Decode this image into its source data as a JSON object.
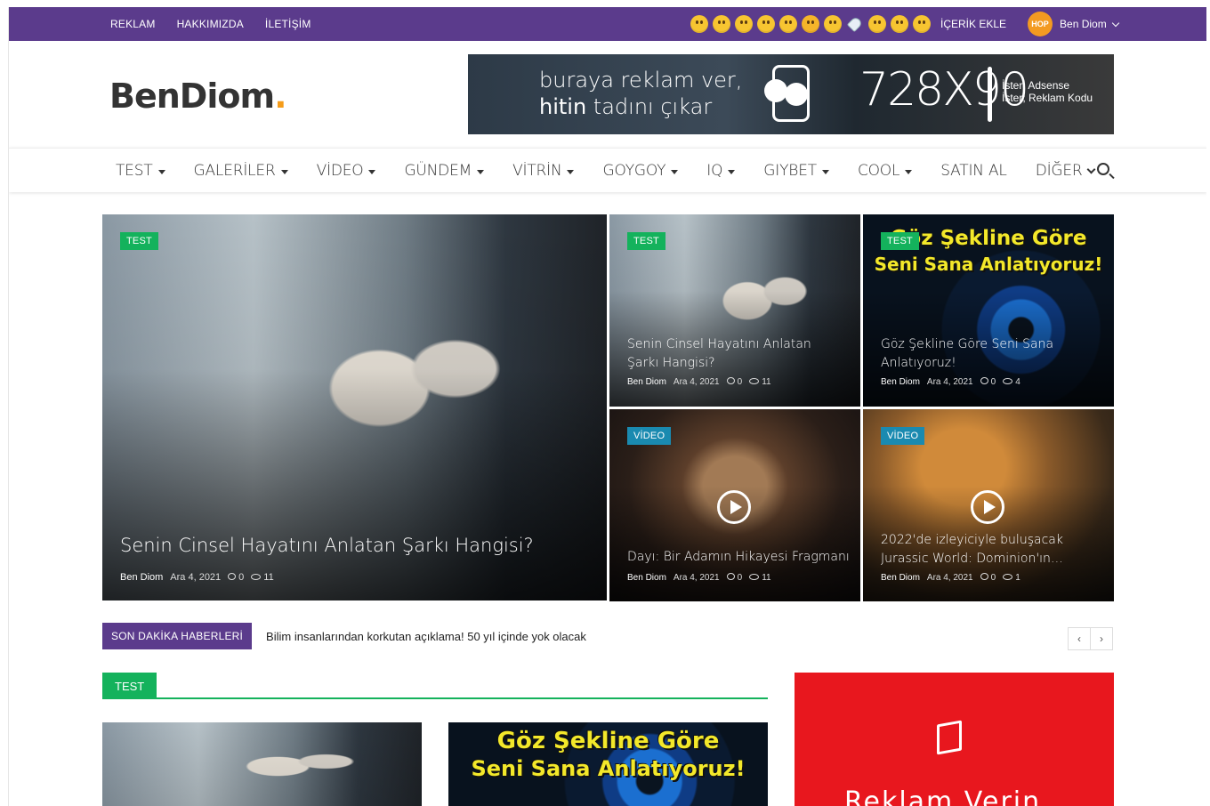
{
  "topbar": {
    "links": [
      "REKLAM",
      "HAKKIMIZDA",
      "İLETİŞİM"
    ],
    "emojis": [
      "crying-face-icon",
      "star-struck-icon",
      "neutral-face-icon",
      "blushing-face-icon",
      "hushed-face-icon",
      "heart-eyes-icon",
      "monocle-face-icon",
      "rocket-icon",
      "laughing-face-icon",
      "flushed-face-icon",
      "sunglasses-face-icon"
    ],
    "add_content": "İÇERİK EKLE",
    "avatar_text": "HOP",
    "username": "Ben Diom"
  },
  "logo": {
    "text": "BenDiom",
    "dot": "."
  },
  "ad_banner": {
    "line1": "buraya reklam ver,",
    "line2_bold": "hitin",
    "line2_rest": " tadını çıkar",
    "size": "728X90",
    "opt1": "İster; Adsense",
    "opt2": "İster; Reklam Kodu"
  },
  "nav": {
    "items": [
      "TEST",
      "GALERİLER",
      "VİDEO",
      "GÜNDEM",
      "VİTRİN",
      "GOYGOY",
      "IQ",
      "GIYBET",
      "COOL",
      "SATIN AL",
      "DİĞER"
    ]
  },
  "featured": [
    {
      "badge": "TEST",
      "title": "Senin Cinsel Hayatını Anlatan Şarkı Hangisi?",
      "author": "Ben Diom",
      "date": "Ara 4, 2021",
      "comments": "0",
      "views": "11"
    },
    {
      "badge": "TEST",
      "title": "Senin Cinsel Hayatını Anlatan Şarkı Hangisi?",
      "author": "Ben Diom",
      "date": "Ara 4, 2021",
      "comments": "0",
      "views": "11"
    },
    {
      "badge": "TEST",
      "title": "Göz Şekline Göre Seni Sana Anlatıyoruz!",
      "author": "Ben Diom",
      "date": "Ara 4, 2021",
      "comments": "0",
      "views": "4",
      "overlay1": "Göz Şekline Göre",
      "overlay2": "Seni Sana Anlatıyoruz!"
    },
    {
      "badge": "VİDEO",
      "title": "Dayı: Bir Adamın Hikayesi Fragmanı",
      "author": "Ben Diom",
      "date": "Ara 4, 2021",
      "comments": "0",
      "views": "11"
    },
    {
      "badge": "VİDEO",
      "title": "2022'de izleyiciyle buluşacak Jurassic World: Dominion'ın…",
      "author": "Ben Diom",
      "date": "Ara 4, 2021",
      "comments": "0",
      "views": "1"
    }
  ],
  "breaking": {
    "label": "SON DAKİKA HABERLERİ",
    "headline": "Bilim insanlarından korkutan açıklama! 50 yıl içinde yok olacak",
    "prev": "‹",
    "next": "›"
  },
  "section": {
    "label": "TEST"
  },
  "cards": [
    {
      "overlay1": "Göz Şekline Göre",
      "overlay2": "Seni Sana Anlatıyoruz!"
    }
  ],
  "side_ad": {
    "text": "Reklam Verin"
  }
}
